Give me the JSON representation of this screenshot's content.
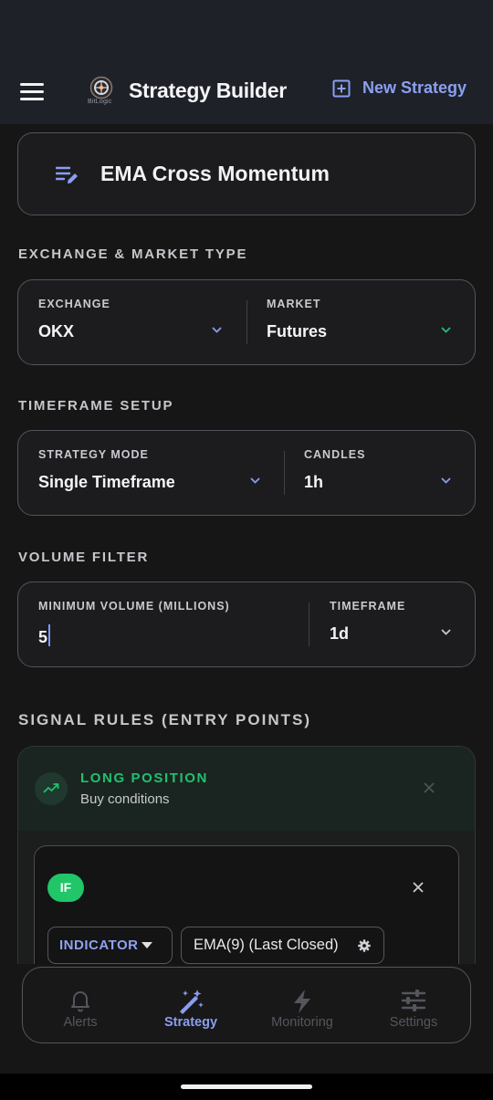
{
  "app": {
    "title": "Strategy Builder",
    "logo_text": "BitLogic",
    "new_strategy_label": "New Strategy"
  },
  "strategy": {
    "name": "EMA Cross Momentum"
  },
  "exchange_section": {
    "title": "EXCHANGE & MARKET TYPE",
    "exchange": {
      "label": "EXCHANGE",
      "value": "OKX"
    },
    "market": {
      "label": "MARKET",
      "value": "Futures"
    }
  },
  "timeframe_section": {
    "title": "TIMEFRAME SETUP",
    "mode": {
      "label": "STRATEGY MODE",
      "value": "Single Timeframe"
    },
    "candles": {
      "label": "CANDLES",
      "value": "1h"
    }
  },
  "volume_section": {
    "title": "VOLUME FILTER",
    "min_volume": {
      "label": "MINIMUM VOLUME (MILLIONS)",
      "value": "5"
    },
    "timeframe": {
      "label": "TIMEFRAME",
      "value": "1d"
    }
  },
  "signal_section": {
    "title": "SIGNAL RULES (ENTRY POINTS)",
    "long": {
      "title": "LONG POSITION",
      "subtitle": "Buy conditions",
      "condition": {
        "badge": "IF",
        "type_label": "INDICATOR",
        "indicator_value": "EMA(9) (Last Closed)"
      }
    }
  },
  "nav": {
    "items": [
      {
        "label": "Alerts",
        "icon": "bell-icon",
        "active": false
      },
      {
        "label": "Strategy",
        "icon": "magic-wand-icon",
        "active": true
      },
      {
        "label": "Monitoring",
        "icon": "lightning-icon",
        "active": false
      },
      {
        "label": "Settings",
        "icon": "sliders-icon",
        "active": false
      }
    ]
  },
  "colors": {
    "accent": "#8a9ef0",
    "long_green": "#22c06e",
    "if_badge": "#20c667",
    "background": "#161616",
    "appbar": "#1f2129"
  }
}
